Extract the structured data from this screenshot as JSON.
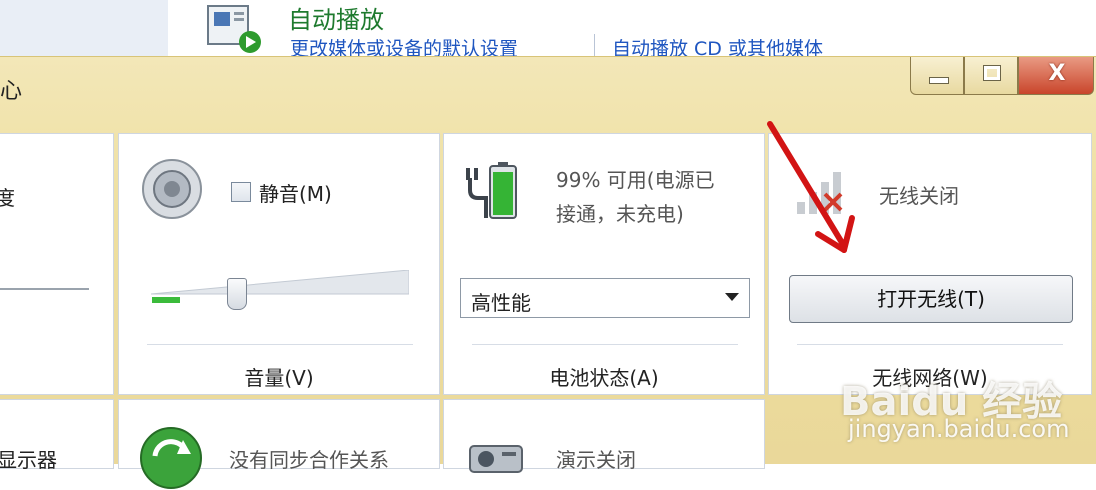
{
  "background_panel": {
    "autoplay_title": "自动播放",
    "link_change_defaults": "更改媒体或设备的默认设置",
    "link_autoplay_cd": "自动播放 CD 或其他媒体"
  },
  "window": {
    "title_fragment": "心",
    "controls": {
      "close_glyph": "X"
    }
  },
  "tiles": {
    "brightness": {
      "label_fragment": "度"
    },
    "volume": {
      "mute_label": "静音(M)",
      "mute_checked": false,
      "level": 0.33,
      "footer": "音量(V)"
    },
    "battery": {
      "status_line1": "99% 可用(电源已",
      "status_line2": "接通，未充电)",
      "plan_selected": "高性能",
      "footer": "电池状态(A)",
      "charge_percent": 99
    },
    "wireless": {
      "status": "无线关闭",
      "button_label": "打开无线(T)",
      "footer": "无线网络(W)"
    },
    "display": {
      "label_fragment": "显示器"
    },
    "sync": {
      "label": "没有同步合作关系"
    },
    "presentation": {
      "label": "演示关闭"
    }
  },
  "watermark": {
    "logo": "Baidu 经验",
    "site": "jingyan.baidu.com"
  },
  "colors": {
    "window_frame": "#ead89a",
    "close_button": "#c9452b",
    "link": "#1f56c0",
    "volume_fill": "#3bbb3b"
  }
}
